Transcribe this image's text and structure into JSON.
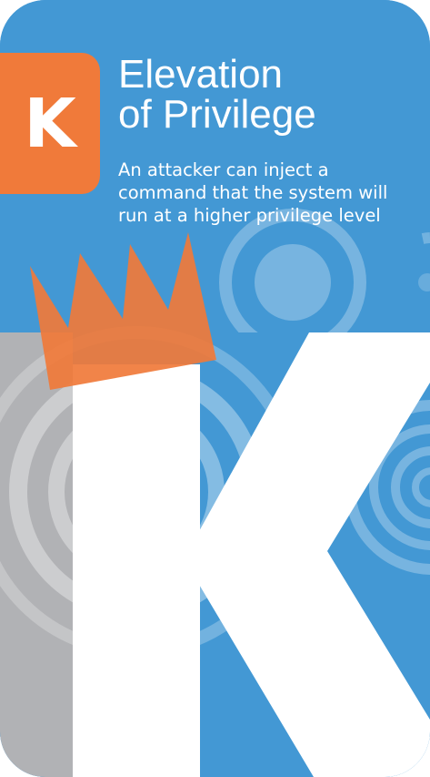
{
  "card": {
    "suit_letter": "K",
    "title_line1": "Elevation",
    "title_line2": "of Privilege",
    "description": "An attacker can inject a command that the system will run at a higher privilege level"
  },
  "colors": {
    "card_blue": "#4398d4",
    "accent_orange": "#f07a3a",
    "panel_gray": "#b1b2b5",
    "text_white": "#ffffff"
  },
  "icons": [
    "crown-icon",
    "concentric-circles-decoration",
    "letter-k-graphic"
  ]
}
